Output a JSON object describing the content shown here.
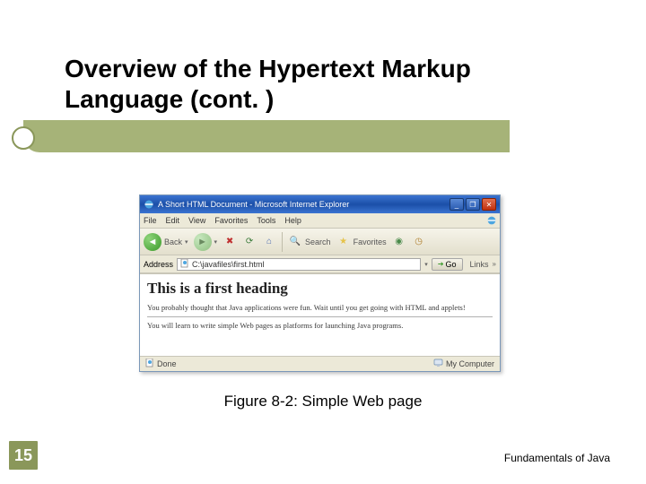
{
  "slide": {
    "title": "Overview of the Hypertext Markup Language (cont. )",
    "number": "15",
    "footer": "Fundamentals of Java",
    "caption": "Figure 8-2: Simple Web page"
  },
  "browser": {
    "title": "A Short HTML Document - Microsoft Internet Explorer",
    "menu": {
      "file": "File",
      "edit": "Edit",
      "view": "View",
      "favorites": "Favorites",
      "tools": "Tools",
      "help": "Help"
    },
    "toolbar": {
      "back": "Back",
      "search": "Search",
      "favorites": "Favorites"
    },
    "addressbar": {
      "label": "Address",
      "path": "C:\\javafiles\\first.html",
      "go": "Go",
      "links": "Links"
    },
    "content": {
      "heading": "This is a first heading",
      "p1": "You probably thought that Java applications were fun. Wait until you get going with HTML and applets!",
      "p2": "You will learn to write simple Web pages as platforms for launching Java programs."
    },
    "status": {
      "left": "Done",
      "right": "My Computer"
    }
  }
}
